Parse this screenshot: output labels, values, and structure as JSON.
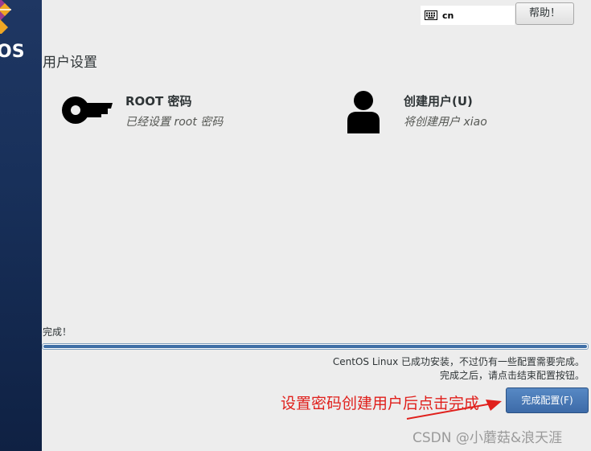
{
  "sidebar": {
    "brand_text": "OS"
  },
  "keyboard": {
    "icon": "keyboard-icon",
    "layout": "cn"
  },
  "help_button": {
    "label": "帮助！"
  },
  "section": {
    "title": "用户设置"
  },
  "spokes": [
    {
      "icon": "key-icon",
      "title": "ROOT 密码",
      "status": "已经设置 root 密码"
    },
    {
      "icon": "user-icon",
      "title": "创建用户(U)",
      "status": "将创建用户 xiao"
    }
  ],
  "progress": {
    "label": "完成！",
    "value": 1.0,
    "color": "#3f6fa6"
  },
  "notice": {
    "line1": "CentOS Linux 已成功安装，不过仍有一些配置需要完成。",
    "line2": "完成之后，请点击结束配置按钮。"
  },
  "finish_button": {
    "label": "完成配置(F)"
  },
  "annotation": {
    "text": "设置密码创建用户后点击完成",
    "color": "#e0201c"
  },
  "watermark": {
    "text": "CSDN @小蘑菇&浪天涯"
  }
}
